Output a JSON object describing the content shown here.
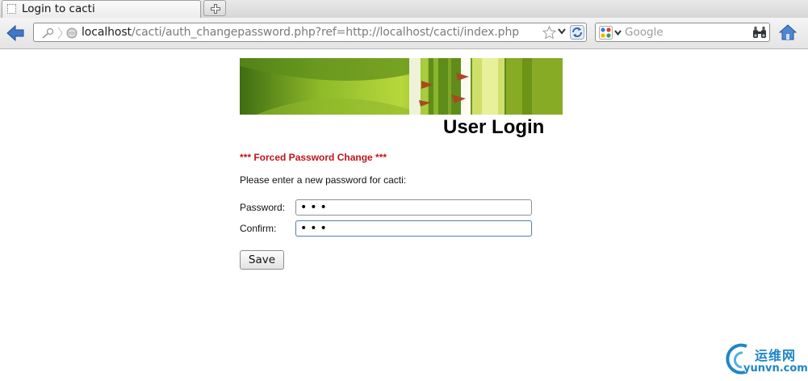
{
  "browser": {
    "tab": {
      "title": "Login to cacti"
    },
    "url": {
      "host": "localhost",
      "path": "/cacti/auth_changepassword.php?ref=http://localhost/cacti/index.php"
    },
    "search": {
      "placeholder": "Google",
      "value": ""
    }
  },
  "page": {
    "heading": "User Login",
    "forced_notice": "*** Forced Password Change ***",
    "instructions": "Please enter a new password for cacti:",
    "fields": {
      "password": {
        "label": "Password:",
        "value": "***"
      },
      "confirm": {
        "label": "Confirm:",
        "value": "***"
      }
    },
    "save_label": "Save"
  },
  "watermark": {
    "chinese": "运维网",
    "domain": "yunvn.com"
  },
  "colors": {
    "notice_red": "#c0141c",
    "accent_blue": "#2a6fc0",
    "banner_green": "#7aa51c",
    "watermark_blue": "#1d86c6"
  }
}
